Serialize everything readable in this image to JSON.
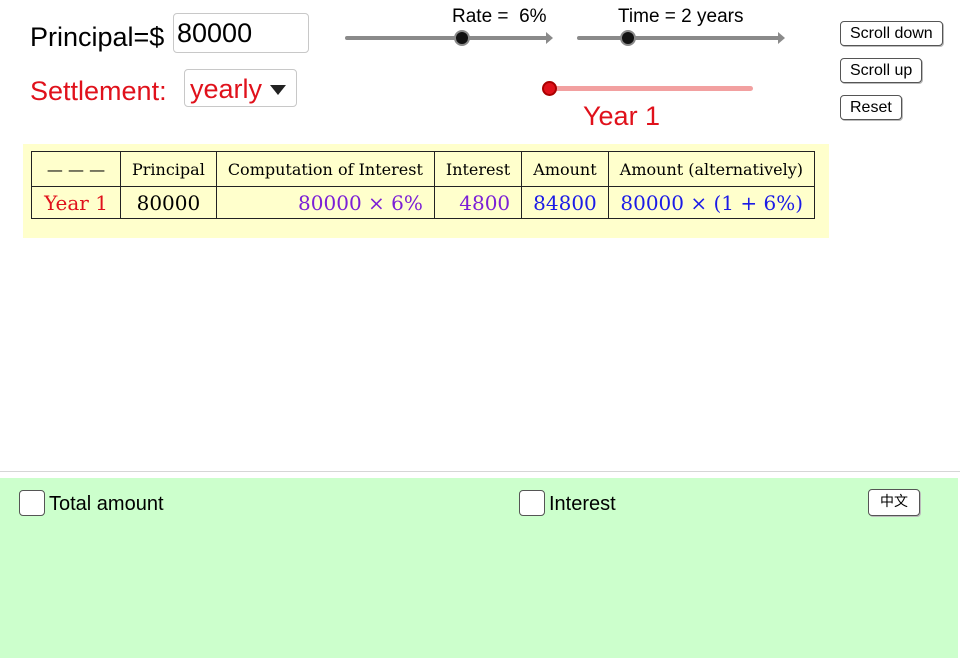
{
  "principal": {
    "label": "Principal=$",
    "value": "80000"
  },
  "settlement": {
    "label": "Settlement:",
    "value": "yearly"
  },
  "rate_slider": {
    "label": "Rate =  6%",
    "value_percent": 6
  },
  "time_slider": {
    "label": "Time = 2 years",
    "value_years": 2
  },
  "year_slider": {
    "label": "Year 1",
    "value": 1
  },
  "buttons": {
    "scroll_down": "Scroll down",
    "scroll_up": "Scroll up",
    "reset": "Reset"
  },
  "table": {
    "headers": [
      "— — —",
      "Principal",
      "Computation of Interest",
      "Interest",
      "Amount",
      "Amount (alternatively)"
    ],
    "rows": [
      {
        "period": "Year 1",
        "principal": "80000",
        "computation": "80000 × 6%",
        "interest": "4800",
        "amount": "84800",
        "amount_alt": "80000 × (1 + 6%)"
      }
    ]
  },
  "options": {
    "total_amount": "Total amount",
    "interest": "Interest"
  },
  "language_button": "中文",
  "colors": {
    "red": "#e0111b",
    "purple": "#7b1fd6",
    "blue": "#1b1be6",
    "table_bg": "#ffffcc",
    "panel_bg": "#ccffcc"
  }
}
